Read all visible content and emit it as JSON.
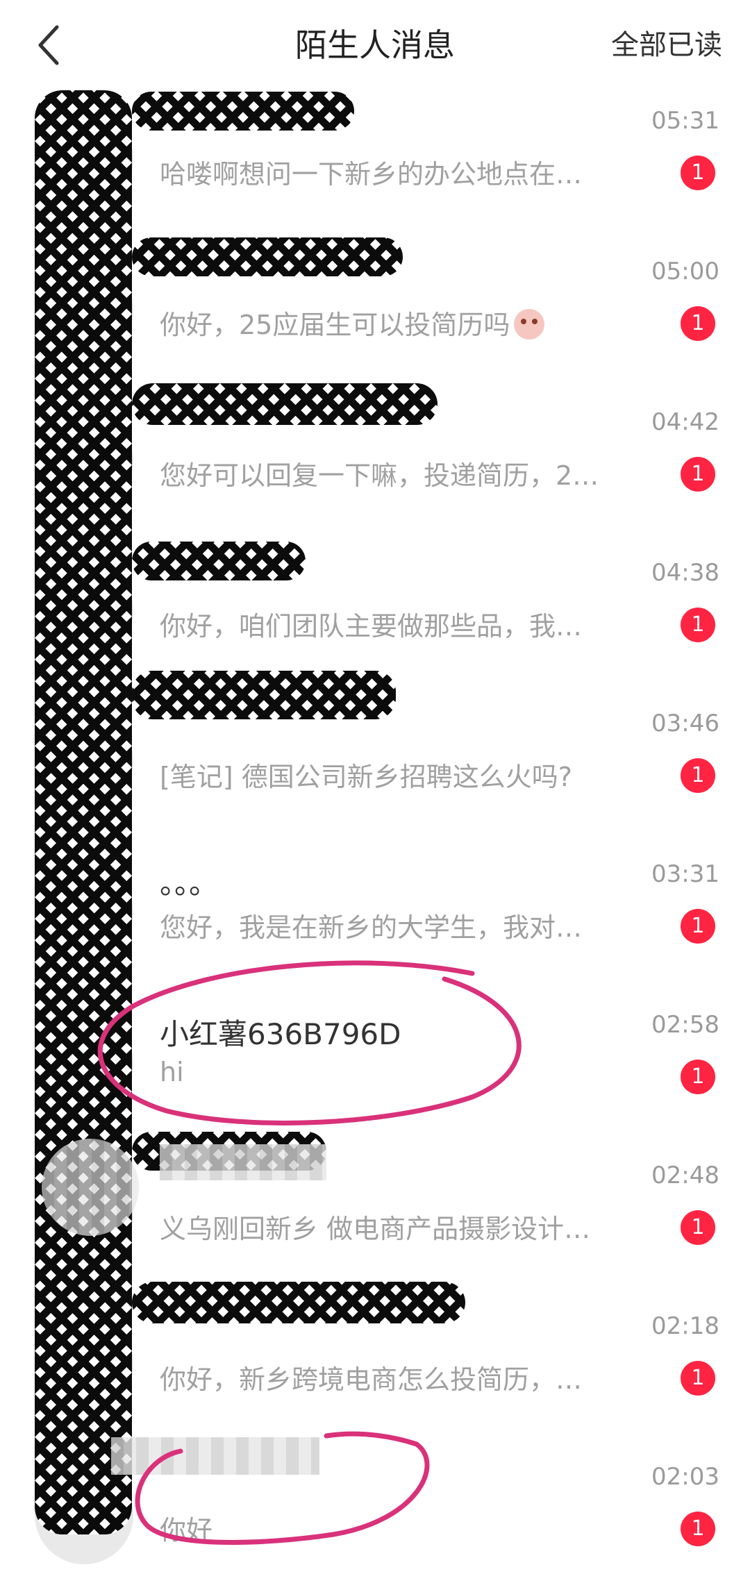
{
  "header": {
    "title": "陌生人消息",
    "mark_all_read": "全部已读"
  },
  "messages": [
    {
      "name": "",
      "preview": "哈喽啊想问一下新乡的办公地点在…",
      "time": "05:31",
      "badge": "1"
    },
    {
      "name": "",
      "preview": "你好，25应届生可以投简历吗",
      "time": "05:00",
      "badge": "1"
    },
    {
      "name": "",
      "preview": "您好可以回复一下嘛，投递简历，2…",
      "time": "04:42",
      "badge": "1"
    },
    {
      "name": "",
      "preview": "你好，咱们团队主要做那些品，我…",
      "time": "04:38",
      "badge": "1"
    },
    {
      "name": "",
      "preview": "[笔记] 德国公司新乡招聘这么火吗?",
      "time": "03:46",
      "badge": "1"
    },
    {
      "name": "。。。",
      "preview": "您好，我是在新乡的大学生，我对…",
      "time": "03:31",
      "badge": "1"
    },
    {
      "name": "小红薯636B796D",
      "preview": "hi",
      "time": "02:58",
      "badge": "1"
    },
    {
      "name": "",
      "preview": "义乌刚回新乡 做电商产品摄影设计…",
      "time": "02:48",
      "badge": "1"
    },
    {
      "name": "",
      "preview": "你好，新乡跨境电商怎么投简历，…",
      "time": "02:18",
      "badge": "1"
    },
    {
      "name": "",
      "preview": "你好",
      "time": "02:03",
      "badge": "1"
    }
  ],
  "colors": {
    "badge": "#ff2442",
    "annotation": "#d9317a"
  },
  "icons": {
    "back": "chevron-left-icon"
  }
}
